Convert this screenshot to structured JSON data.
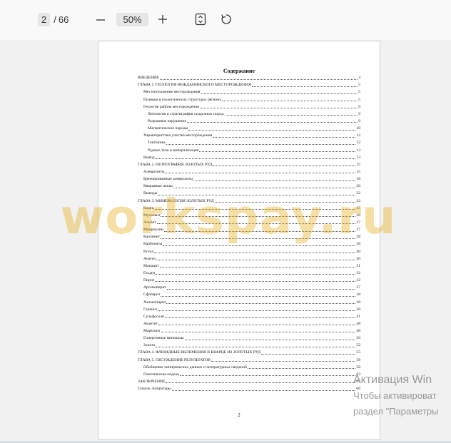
{
  "toolbar": {
    "current_page": "2",
    "page_separator": "/",
    "total_pages": "66",
    "zoom": "50%",
    "icons": {
      "zoom_out": "minus-icon",
      "zoom_in": "plus-icon",
      "fit": "fit-page-icon",
      "rotate": "rotate-icon"
    }
  },
  "document": {
    "title": "Содержание",
    "page_number": "2",
    "toc": [
      {
        "text": "ВВЕДЕНИЕ",
        "page": "3",
        "level": 0
      },
      {
        "text": "ГЛАВА 1. ГЕОЛОГИЯ НЕЖДАНИНСКОГО МЕСТОРОЖДЕНИЯ",
        "page": "5",
        "level": 0
      },
      {
        "text": "Местоположение месторождения",
        "page": "5",
        "level": 1
      },
      {
        "text": "Позиция в геологических структурах региона",
        "page": "5",
        "level": 1
      },
      {
        "text": "Геология района месторождения",
        "page": "9",
        "level": 1
      },
      {
        "text": "Литология и стратиграфия осадочных пород.",
        "page": "9",
        "level": 2
      },
      {
        "text": "Разрывные нарушения",
        "page": "9",
        "level": 2
      },
      {
        "text": "Магматические породы",
        "page": "10",
        "level": 2
      },
      {
        "text": "Характеристика участка месторождения",
        "page": "12",
        "level": 1
      },
      {
        "text": "Тектоника",
        "page": "12",
        "level": 2
      },
      {
        "text": "Рудные тела и минерализация",
        "page": "13",
        "level": 2
      },
      {
        "text": "Вывод",
        "page": "13",
        "level": 1
      },
      {
        "text": "ГЛАВА 2. ПЕТРОГРАФИЯ ЗОЛОТЫХ РУД",
        "page": "15",
        "level": 0
      },
      {
        "text": "Алевролиты",
        "page": "15",
        "level": 1
      },
      {
        "text": "Брекчированные алевролиты",
        "page": "18",
        "level": 1
      },
      {
        "text": "Кварцевые жилы",
        "page": "20",
        "level": 1
      },
      {
        "text": "Выводы",
        "page": "22",
        "level": 1
      },
      {
        "text": "ГЛАВА 3. МИНЕРАЛОГИЯ ЗОЛОТЫХ РУД",
        "page": "23",
        "level": 0
      },
      {
        "text": "Кварц",
        "page": "25",
        "level": 1
      },
      {
        "text": "Мусковит",
        "page": "26",
        "level": 1
      },
      {
        "text": "Альбит",
        "page": "27",
        "level": 1
      },
      {
        "text": "Микроклин",
        "page": "27",
        "level": 1
      },
      {
        "text": "Каолинит",
        "page": "28",
        "level": 1
      },
      {
        "text": "Карбонаты",
        "page": "28",
        "level": 1
      },
      {
        "text": "Рутил",
        "page": "30",
        "level": 1
      },
      {
        "text": "Апатит",
        "page": "30",
        "level": 1
      },
      {
        "text": "Монацит",
        "page": "31",
        "level": 1
      },
      {
        "text": "Гохдит",
        "page": "32",
        "level": 1
      },
      {
        "text": "Пирит",
        "page": "32",
        "level": 1
      },
      {
        "text": "Арсенопирит",
        "page": "37",
        "level": 1
      },
      {
        "text": "Сфалерит",
        "page": "38",
        "level": 1
      },
      {
        "text": "Халькопирит",
        "page": "38",
        "level": 1
      },
      {
        "text": "Галенит",
        "page": "38",
        "level": 1
      },
      {
        "text": "Сульфосоли",
        "page": "41",
        "level": 1
      },
      {
        "text": "Акантит",
        "page": "48",
        "level": 1
      },
      {
        "text": "Маркизит",
        "page": "48",
        "level": 1
      },
      {
        "text": "Гипергенные минералы",
        "page": "50",
        "level": 1
      },
      {
        "text": "Золото",
        "page": "52",
        "level": 1
      },
      {
        "text": "ГЛАВА 4. ФЛЮИДНЫЕ ВКЛЮЧЕНИЯ В КВАРЦЕ ИЗ ЗОЛОТЫХ РУД",
        "page": "55",
        "level": 0
      },
      {
        "text": "ГЛАВА 5. ОБСУЖДЕНИЕ РЕЗУЛЬТАТОВ",
        "page": "58",
        "level": 0
      },
      {
        "text": "Обобщение эмпирических данных и литературных сведений",
        "page": "58",
        "level": 1
      },
      {
        "text": "Генетическая модель",
        "page": "63",
        "level": 1
      },
      {
        "text": "ЗАКЛЮЧЕНИЕ",
        "page": "65",
        "level": 0
      },
      {
        "text": "Список литературы",
        "page": "66",
        "level": 0
      }
    ]
  },
  "watermark": {
    "text": "workspay.ru",
    "color": "#e8b01e"
  },
  "os_overlay": {
    "title": "Активация Win",
    "line1": "Чтобы активироват",
    "line2": "раздел \"Параметры"
  }
}
